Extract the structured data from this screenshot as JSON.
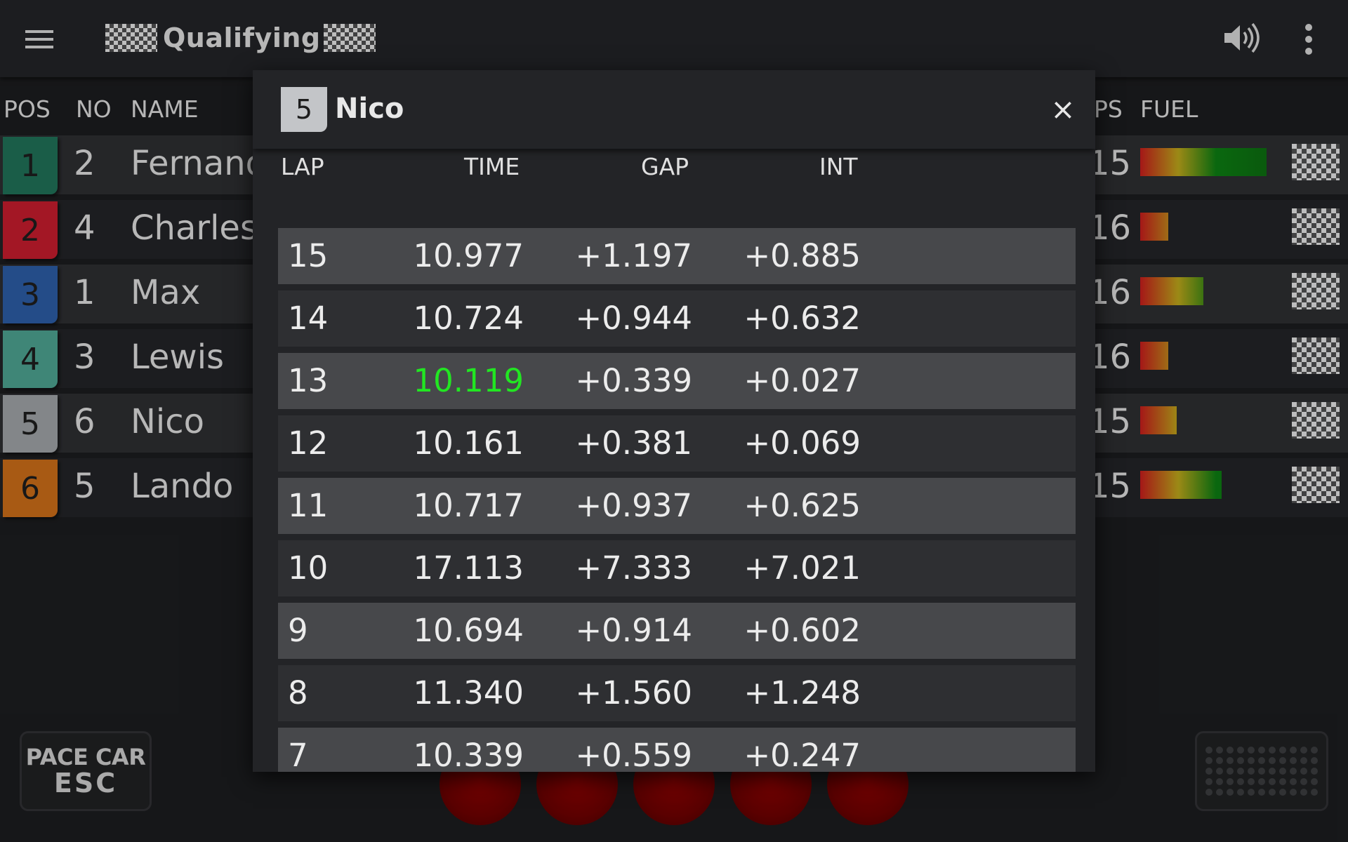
{
  "app": {
    "title": "Qualifying"
  },
  "columns": {
    "pos": "POS",
    "no": "NO",
    "name": "NAME",
    "laps": "PS",
    "fuel": "FUEL"
  },
  "drivers": [
    {
      "pos": "1",
      "no": "2",
      "name": "Fernand",
      "laps": "15",
      "fuel": 0.9,
      "color": "#1f6e55"
    },
    {
      "pos": "2",
      "no": "4",
      "name": "Charles",
      "laps": "16",
      "fuel": 0.2,
      "color": "#c01c2c"
    },
    {
      "pos": "3",
      "no": "1",
      "name": "Max",
      "laps": "16",
      "fuel": 0.45,
      "color": "#2b5aa0"
    },
    {
      "pos": "4",
      "no": "3",
      "name": "Lewis",
      "laps": "16",
      "fuel": 0.2,
      "color": "#4a9e8c"
    },
    {
      "pos": "5",
      "no": "6",
      "name": "Nico",
      "laps": "15",
      "fuel": 0.26,
      "color": "#9b9ea1"
    },
    {
      "pos": "6",
      "no": "5",
      "name": "Lando",
      "laps": "15",
      "fuel": 0.58,
      "color": "#c66a18"
    }
  ],
  "buttons": {
    "pace_car_line1": "PACE CAR",
    "pace_car_line2": "ESC"
  },
  "dialog": {
    "badge": "5",
    "title": "Nico",
    "close": "×",
    "headers": {
      "lap": "LAP",
      "time": "TIME",
      "gap": "GAP",
      "int": "INT"
    },
    "laps": [
      {
        "lap": "15",
        "time": "10.977",
        "gap": "+1.197",
        "int": "+0.885",
        "best": false
      },
      {
        "lap": "14",
        "time": "10.724",
        "gap": "+0.944",
        "int": "+0.632",
        "best": false
      },
      {
        "lap": "13",
        "time": "10.119",
        "gap": "+0.339",
        "int": "+0.027",
        "best": true
      },
      {
        "lap": "12",
        "time": "10.161",
        "gap": "+0.381",
        "int": "+0.069",
        "best": false
      },
      {
        "lap": "11",
        "time": "10.717",
        "gap": "+0.937",
        "int": "+0.625",
        "best": false
      },
      {
        "lap": "10",
        "time": "17.113",
        "gap": "+7.333",
        "int": "+7.021",
        "best": false
      },
      {
        "lap": "9",
        "time": "10.694",
        "gap": "+0.914",
        "int": "+0.602",
        "best": false
      },
      {
        "lap": "8",
        "time": "11.340",
        "gap": "+1.560",
        "int": "+1.248",
        "best": false
      },
      {
        "lap": "7",
        "time": "10.339",
        "gap": "+0.559",
        "int": "+0.247",
        "best": false
      }
    ]
  },
  "colors": {
    "best_lap": "#22e622",
    "start_light": "#6a0000"
  }
}
